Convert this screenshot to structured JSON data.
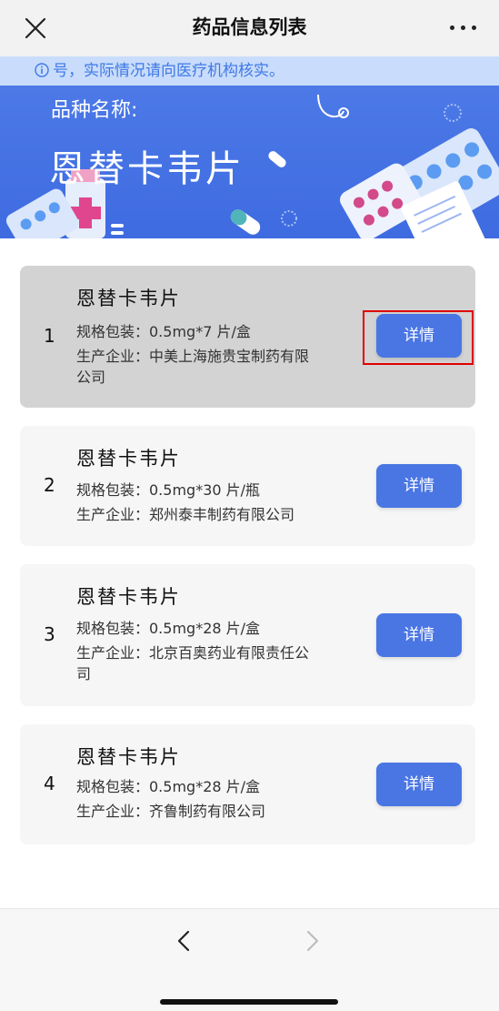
{
  "navbar": {
    "title": "药品信息列表",
    "close_icon": "close-icon",
    "more_icon": "more-icon"
  },
  "banner": {
    "notice": "号，实际情况请向医疗机构核实。",
    "label": "品种名称:",
    "drug_name": "恩替卡韦片",
    "colors": {
      "primary": "#4a76e4",
      "notice_bg": "#c9dcfb",
      "notice_text": "#3f79e6"
    }
  },
  "list": {
    "items": [
      {
        "index": "1",
        "name": "恩替卡韦片",
        "spec": "规格包装：0.5mg*7 片/盒",
        "maker_line1": "生产企业：中美上海施贵宝制药有限",
        "maker_line2": "公司",
        "button": "详情"
      },
      {
        "index": "2",
        "name": "恩替卡韦片",
        "spec": "规格包装：0.5mg*30 片/瓶",
        "maker_line1": "生产企业：郑州泰丰制药有限公司",
        "maker_line2": "",
        "button": "详情"
      },
      {
        "index": "3",
        "name": "恩替卡韦片",
        "spec": "规格包装：0.5mg*28 片/盒",
        "maker_line1": "生产企业：北京百奥药业有限责任公",
        "maker_line2": "司",
        "button": "详情"
      },
      {
        "index": "4",
        "name": "恩替卡韦片",
        "spec": "规格包装：0.5mg*28 片/盒",
        "maker_line1": "生产企业：齐鲁制药有限公司",
        "maker_line2": "",
        "button": "详情"
      }
    ]
  },
  "bottom_bar": {
    "back_icon": "chevron-left-icon",
    "forward_icon": "chevron-right-icon"
  }
}
